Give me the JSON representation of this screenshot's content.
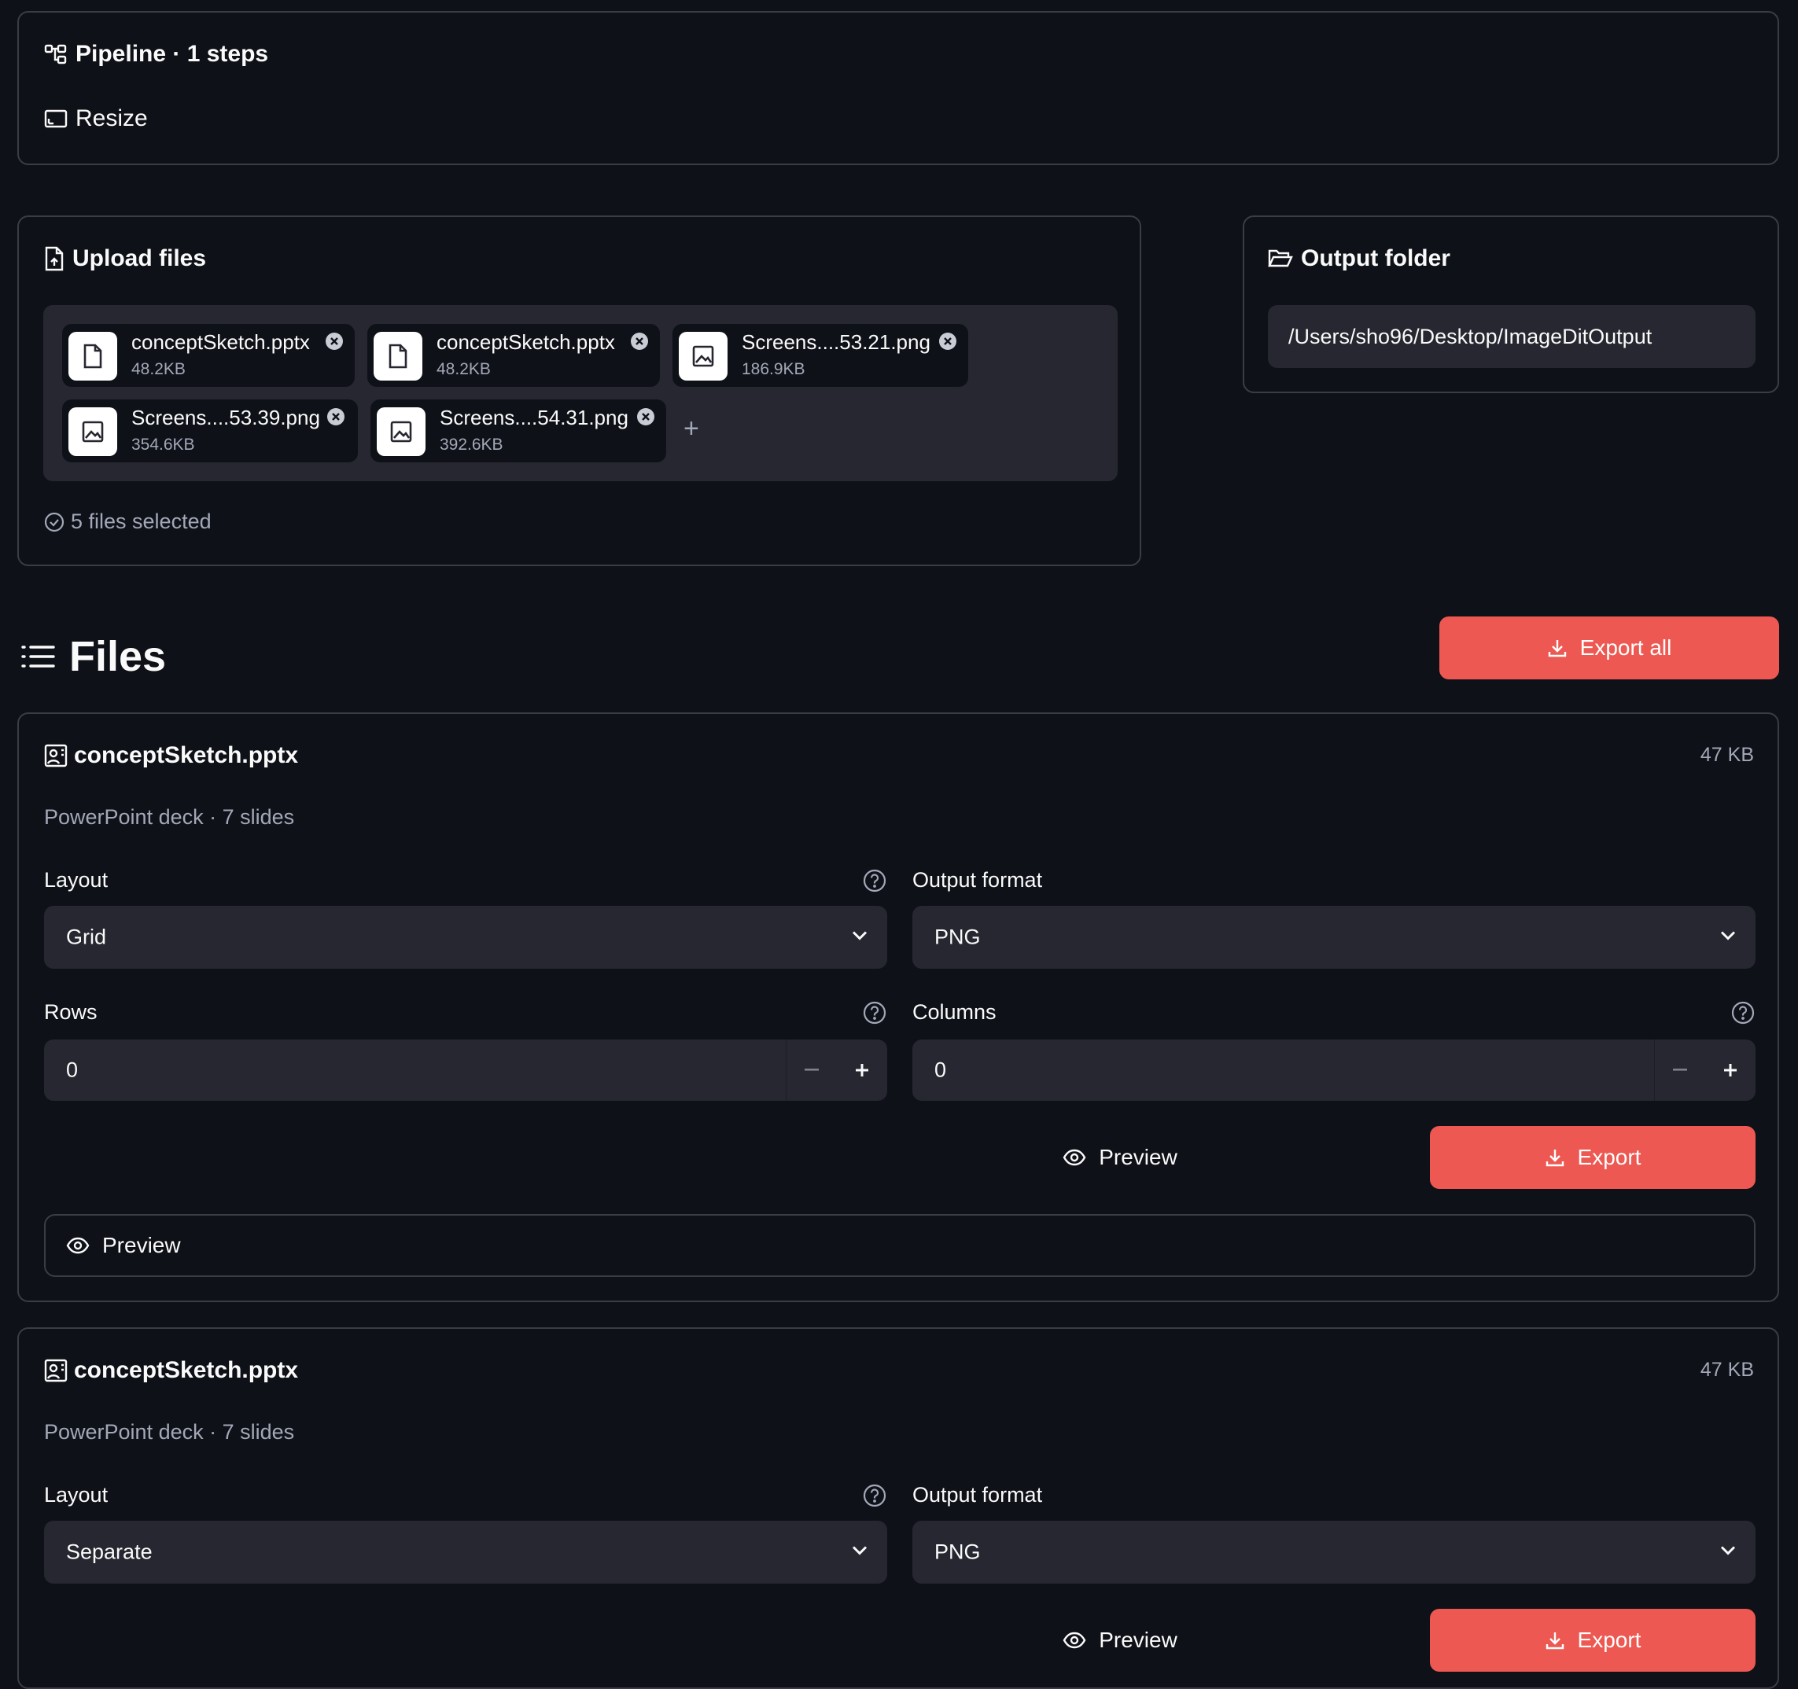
{
  "pipeline": {
    "title": "Pipeline · 1 steps",
    "step": "Resize"
  },
  "upload": {
    "title": "Upload files",
    "files": [
      {
        "name": "conceptSketch.pptx",
        "size": "48.2KB",
        "kind": "document-icon"
      },
      {
        "name": "conceptSketch.pptx",
        "size": "48.2KB",
        "kind": "document-icon"
      },
      {
        "name": "Screens....53.21.png",
        "size": "186.9KB",
        "kind": "image-icon"
      },
      {
        "name": "Screens....53.39.png",
        "size": "354.6KB",
        "kind": "image-icon"
      },
      {
        "name": "Screens....54.31.png",
        "size": "392.6KB",
        "kind": "image-icon"
      }
    ],
    "add": "+",
    "status": "5 files selected"
  },
  "output": {
    "title": "Output folder",
    "path": "/Users/sho96/Desktop/ImageDitOutput"
  },
  "files_section": {
    "title": "Files",
    "export_all": "Export all"
  },
  "cards": [
    {
      "name": "conceptSketch.pptx",
      "size": "47 KB",
      "subtitle": "PowerPoint deck · 7 slides",
      "layout_label": "Layout",
      "layout_value": "Grid",
      "format_label": "Output format",
      "format_value": "PNG",
      "rows_label": "Rows",
      "rows_value": "0",
      "columns_label": "Columns",
      "columns_value": "0",
      "preview_label": "Preview",
      "export_label": "Export",
      "expander_label": "Preview"
    },
    {
      "name": "conceptSketch.pptx",
      "size": "47 KB",
      "subtitle": "PowerPoint deck · 7 slides",
      "layout_label": "Layout",
      "layout_value": "Separate",
      "format_label": "Output format",
      "format_value": "PNG",
      "preview_label": "Preview",
      "export_label": "Export"
    }
  ],
  "colors": {
    "background": "#0e1117",
    "surface": "#262730",
    "border": "#3a3d46",
    "accent": "#ed5952",
    "muted_text": "#a3a8b8"
  }
}
